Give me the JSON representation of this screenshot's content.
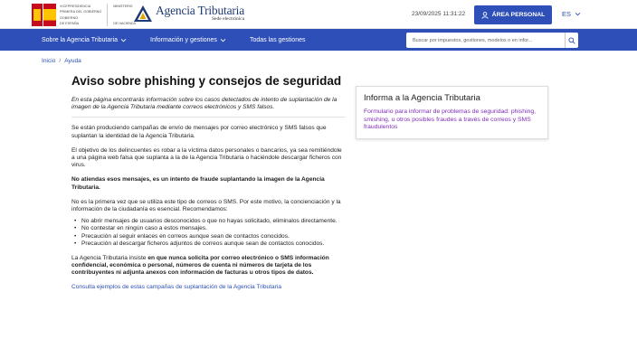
{
  "header": {
    "gov_lines": [
      "Vicepresidencia",
      "Primera del Gobierno",
      "Gobierno",
      "de España"
    ],
    "gov_ministry": [
      "Ministerio",
      "de Hacienda"
    ],
    "agency_name": "Agencia Tributaria",
    "agency_sub": "Sede electrónica",
    "timestamp": "23/09/2025 11:31:22",
    "personal_area": "ÁREA PERSONAL",
    "language": "ES"
  },
  "nav": {
    "items": [
      {
        "label": "Sobre la Agencia Tributaria"
      },
      {
        "label": "Información y gestiones"
      },
      {
        "label": "Todas las gestiones"
      }
    ],
    "search_placeholder": "Buscar por impuestos, gestiones, modelos o en infor..."
  },
  "breadcrumb": {
    "home": "Inicio",
    "current": "Ayuda"
  },
  "main": {
    "title": "Aviso sobre phishing y consejos de seguridad",
    "intro": "En esta página encontrarás información sobre los casos detectados de intento de suplantación de la imagen de la Agencia Tributaria mediante correos electrónicos y SMS falsos.",
    "p1": "Se están produciendo campañas de envío de mensajes por correo electrónico y SMS falsos que suplantan la identidad de la Agencia Tributaria.",
    "p2": "El objetivo de los delincuentes es robar a la víctima datos personales o bancarios, ya sea remitiéndole a una página web falsa que suplanta a la de la Agencia Tributaria o haciéndole descargar ficheros con virus.",
    "p3": "No atiendas esos mensajes, es un intento de fraude suplantando la imagen de la Agencia Tributaria.",
    "p4": "No es la primera vez que se utiliza este tipo de correos o SMS. Por este motivo, la concienciación y la información de la ciudadanía es esencial. Recomendamos:",
    "tips": [
      "No abrir mensajes de usuarios desconocidos o que no hayas solicitado, eliminalos directamente.",
      "No contestar en ningún caso a estos mensajes.",
      "Precaución al seguir enlaces en correos aunque sean de contactos conocidos.",
      "Precaución al descargar ficheros adjuntos de correos aunque sean de contactos conocidos."
    ],
    "p5_start": "La Agencia Tributaria insiste ",
    "p5_bold": "en que nunca solicita por correo electrónico o SMS información confidencial, económica o personal, números de cuenta ni números de tarjeta de los contribuyentes ni adjunta anexos con información de facturas u otros tipos de datos.",
    "link": "Consulta ejemplos de estas campañas de suplantación de la Agencia Tributaria"
  },
  "aside": {
    "title": "Informa a la Agencia Tributaria",
    "link": "Formulario para informar de problemas de seguridad: phishing, smishing, u otros posibles fraudes a través de correos y SMS fraudulentos"
  },
  "colors": {
    "brand_blue": "#2d4fb7",
    "link_purple": "#7e2bb8"
  }
}
